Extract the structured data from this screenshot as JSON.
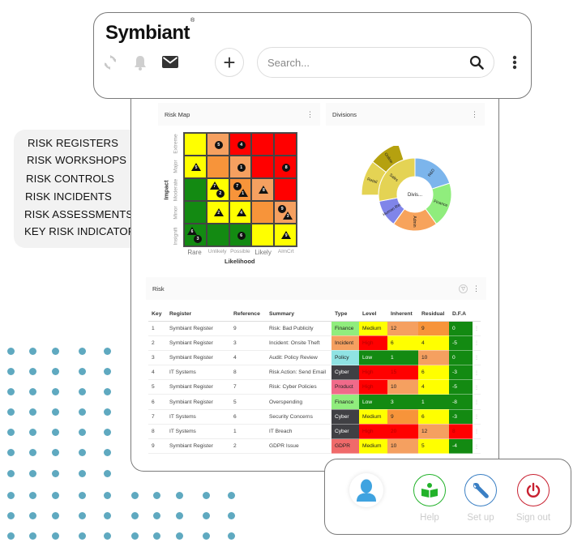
{
  "brand": {
    "name": "Symbiant",
    "registered_mark": "®"
  },
  "toolbar": {
    "icons": [
      "refresh-icon",
      "bell-icon",
      "mail-icon"
    ],
    "add_button": "+",
    "search_placeholder": "Search...",
    "menu_icon": "kebab-icon"
  },
  "sidebar": {
    "items": [
      {
        "label": "RISK REGISTERS"
      },
      {
        "label": "RISK WORKSHOPS"
      },
      {
        "label": "RISK CONTROLS"
      },
      {
        "label": "RISK INCIDENTS"
      },
      {
        "label": "RISK ASSESSMENTS"
      },
      {
        "label": "KEY RISK INDICATORS"
      }
    ]
  },
  "risk_map": {
    "title": "Risk Map",
    "y_axis_title": "Impact",
    "x_axis_title": "Likelihood",
    "y_labels": [
      "Extreme",
      "Major",
      "Moderate",
      "Minor",
      "Insignificant"
    ],
    "x_labels": [
      "Rare",
      "Unlikely",
      "Possible",
      "Likely",
      "Almost Certain"
    ],
    "cell_colors": [
      [
        "#ffff00",
        "#f5a060",
        "#ff0000",
        "#ff0000",
        "#ff0000"
      ],
      [
        "#ffff00",
        "#f7943a",
        "#f5a060",
        "#ff0000",
        "#ff0000"
      ],
      [
        "#138a12",
        "#ffff00",
        "#f7943a",
        "#f5a060",
        "#ff0000"
      ],
      [
        "#138a12",
        "#ffff00",
        "#ffff00",
        "#f7943a",
        "#f5a060"
      ],
      [
        "#138a12",
        "#138a12",
        "#138a12",
        "#ffff00",
        "#ffff00"
      ]
    ],
    "markers": [
      {
        "row": 0,
        "col": 1,
        "shape": "circle",
        "label": "5"
      },
      {
        "row": 0,
        "col": 2,
        "shape": "circle",
        "label": "4"
      },
      {
        "row": 1,
        "col": 0,
        "shape": "triangle",
        "label": "5"
      },
      {
        "row": 1,
        "col": 2,
        "shape": "circle",
        "label": "1"
      },
      {
        "row": 1,
        "col": 4,
        "shape": "circle",
        "label": "8"
      },
      {
        "row": 2,
        "col": 1,
        "shape": "triangle",
        "label": "7"
      },
      {
        "row": 2,
        "col": 1,
        "shape": "circle",
        "label": "2"
      },
      {
        "row": 2,
        "col": 2,
        "shape": "circle",
        "label": "7"
      },
      {
        "row": 2,
        "col": 2,
        "shape": "triangle",
        "label": "1"
      },
      {
        "row": 2,
        "col": 3,
        "shape": "triangle",
        "label": "8"
      },
      {
        "row": 3,
        "col": 1,
        "shape": "triangle",
        "label": "2"
      },
      {
        "row": 3,
        "col": 2,
        "shape": "triangle",
        "label": "4"
      },
      {
        "row": 3,
        "col": 4,
        "shape": "circle",
        "label": "9"
      },
      {
        "row": 3,
        "col": 4,
        "shape": "triangle",
        "label": "3"
      },
      {
        "row": 4,
        "col": 0,
        "shape": "triangle",
        "label": "6"
      },
      {
        "row": 4,
        "col": 0,
        "shape": "circle",
        "label": "3"
      },
      {
        "row": 4,
        "col": 2,
        "shape": "circle",
        "label": "6"
      },
      {
        "row": 4,
        "col": 4,
        "shape": "triangle",
        "label": "9"
      }
    ]
  },
  "divisions": {
    "title": "Divisions",
    "center_label": "Divis...",
    "inner": [
      {
        "label": "R&D",
        "value": 1,
        "color": "#7cb5ec"
      },
      {
        "label": "Finance",
        "value": 1,
        "color": "#90ed7d"
      },
      {
        "label": "Admin",
        "value": 1,
        "color": "#f7a35c"
      },
      {
        "label": "Human Resources",
        "value": 0.6,
        "color": "#8085e9"
      },
      {
        "label": "Sales",
        "value": 1.4,
        "color": "#e4d354"
      }
    ],
    "outer": [
      {
        "label": "Online",
        "parent": "Sales",
        "color": "#b5a10f"
      },
      {
        "label": "Retail",
        "parent": "Sales",
        "color": "#e4d354"
      }
    ]
  },
  "risk_table": {
    "title": "Risk",
    "columns": [
      "Key",
      "Register",
      "Reference",
      "Summary",
      "Type",
      "Level",
      "Inherent",
      "Residual",
      "D.F.A"
    ],
    "rows": [
      {
        "key": "1",
        "register": "Symbiant Register",
        "reference": "9",
        "summary": "Risk: Bad Publicity",
        "type": "Finance",
        "level": "Medium",
        "inherent": "12",
        "residual": "9",
        "dfa": "0"
      },
      {
        "key": "2",
        "register": "Symbiant Register",
        "reference": "3",
        "summary": "Incident: Onsite Theft",
        "type": "Incident",
        "level": "High",
        "inherent": "6",
        "residual": "4",
        "dfa": "-5"
      },
      {
        "key": "3",
        "register": "Symbiant Register",
        "reference": "4",
        "summary": "Audit: Policy Review",
        "type": "Policy",
        "level": "Low",
        "inherent": "1",
        "residual": "10",
        "dfa": "0"
      },
      {
        "key": "4",
        "register": "IT Systems",
        "reference": "8",
        "summary": "Risk Action: Send Email",
        "type": "Cyber",
        "level": "High",
        "inherent": "15",
        "residual": "6",
        "dfa": "-3"
      },
      {
        "key": "5",
        "register": "Symbiant Register",
        "reference": "7",
        "summary": "Risk: Cyber Policies",
        "type": "Product",
        "level": "High",
        "inherent": "10",
        "residual": "4",
        "dfa": "-5"
      },
      {
        "key": "6",
        "register": "Symbiant Register",
        "reference": "5",
        "summary": "Overspending",
        "type": "Finance",
        "level": "Low",
        "inherent": "3",
        "residual": "1",
        "dfa": "-8"
      },
      {
        "key": "7",
        "register": "IT Systems",
        "reference": "6",
        "summary": "Security Concerns",
        "type": "Cyber",
        "level": "Medium",
        "inherent": "9",
        "residual": "6",
        "dfa": "-3"
      },
      {
        "key": "8",
        "register": "IT Systems",
        "reference": "1",
        "summary": "IT Breach",
        "type": "Cyber",
        "level": "High",
        "inherent": "20",
        "residual": "12",
        "dfa": "8"
      },
      {
        "key": "9",
        "register": "Symbiant Register",
        "reference": "2",
        "summary": "GDPR Issue",
        "type": "GDPR",
        "level": "Medium",
        "inherent": "10",
        "residual": "5",
        "dfa": "-4"
      }
    ],
    "colors": {
      "type": {
        "Finance": "#90ed7d",
        "Incident": "#f5a060",
        "Policy": "#8fe3e3",
        "Cyber": "#404044",
        "Product": "#f06a8a",
        "GDPR": "#f06a6a"
      },
      "level": {
        "Medium": "#ffff00",
        "High": "#ff0000",
        "Low": "#138a12"
      },
      "score": {
        "12": "#f5a060",
        "9": "#f7943a",
        "6": "#ffff00",
        "4": "#ffff00",
        "1": "#138a12",
        "10": "#f5a060",
        "15": "#ff0000",
        "3": "#138a12",
        "20": "#ff0000",
        "5": "#ffff00"
      },
      "dfa": {
        "0": "#138a12",
        "-5": "#138a12",
        "-3": "#138a12",
        "-8": "#138a12",
        "8": "#ff0000",
        "-4": "#138a12"
      }
    }
  },
  "user_menu": {
    "items": [
      {
        "label": "Help",
        "color": "#22b22a"
      },
      {
        "label": "Set up",
        "color": "#3a7fc4"
      },
      {
        "label": "Sign out",
        "color": "#c82030"
      }
    ]
  }
}
